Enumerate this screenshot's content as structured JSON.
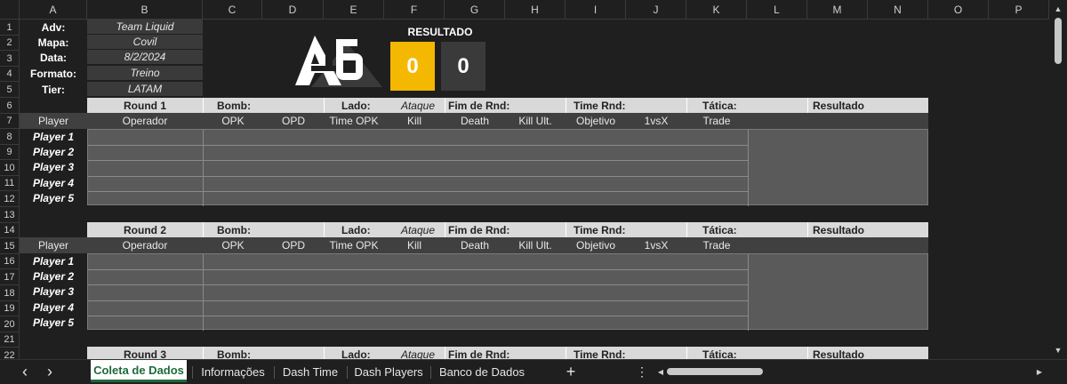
{
  "columns": [
    "A",
    "B",
    "C",
    "D",
    "E",
    "F",
    "G",
    "H",
    "I",
    "J",
    "K",
    "L",
    "M",
    "N",
    "O",
    "P"
  ],
  "rows": [
    "1",
    "2",
    "3",
    "4",
    "5",
    "6",
    "7",
    "8",
    "9",
    "10",
    "11",
    "12",
    "13",
    "14",
    "15",
    "16",
    "17",
    "18",
    "19",
    "20",
    "21",
    "22"
  ],
  "info": {
    "labels": [
      "Adv:",
      "Mapa:",
      "Data:",
      "Formato:",
      "Tier:"
    ],
    "values": [
      "Team Liquid",
      "Covil",
      "8/2/2024",
      "Treino",
      "LATAM"
    ]
  },
  "score": {
    "title": "RESULTADO",
    "left": "0",
    "right": "0",
    "left_color": "#f5b800",
    "right_color": "#3a3a3a"
  },
  "round_header": {
    "bomb": "Bomb:",
    "lado": "Lado:",
    "lado_value": "Ataque",
    "fim": "Fim de Rnd:",
    "time_rnd": "Time Rnd:",
    "tatica": "Tática:",
    "resultado": "Resultado"
  },
  "rounds": [
    "Round 1",
    "Round 2",
    "Round 3"
  ],
  "subheader": [
    "Player",
    "Operador",
    "OPK",
    "OPD",
    "Time OPK",
    "Kill",
    "Death",
    "Kill Ult.",
    "Objetivo",
    "1vsX",
    "Trade"
  ],
  "players": [
    "Player 1",
    "Player 2",
    "Player 3",
    "Player 4",
    "Player 5"
  ],
  "tabs": [
    "Coleta de Dados",
    "Informações",
    "Dash Time",
    "Dash Players",
    "Banco de Dados"
  ],
  "tab_add": "+",
  "tab_more": "⋮",
  "nav": {
    "prev": "‹",
    "next": "›"
  }
}
